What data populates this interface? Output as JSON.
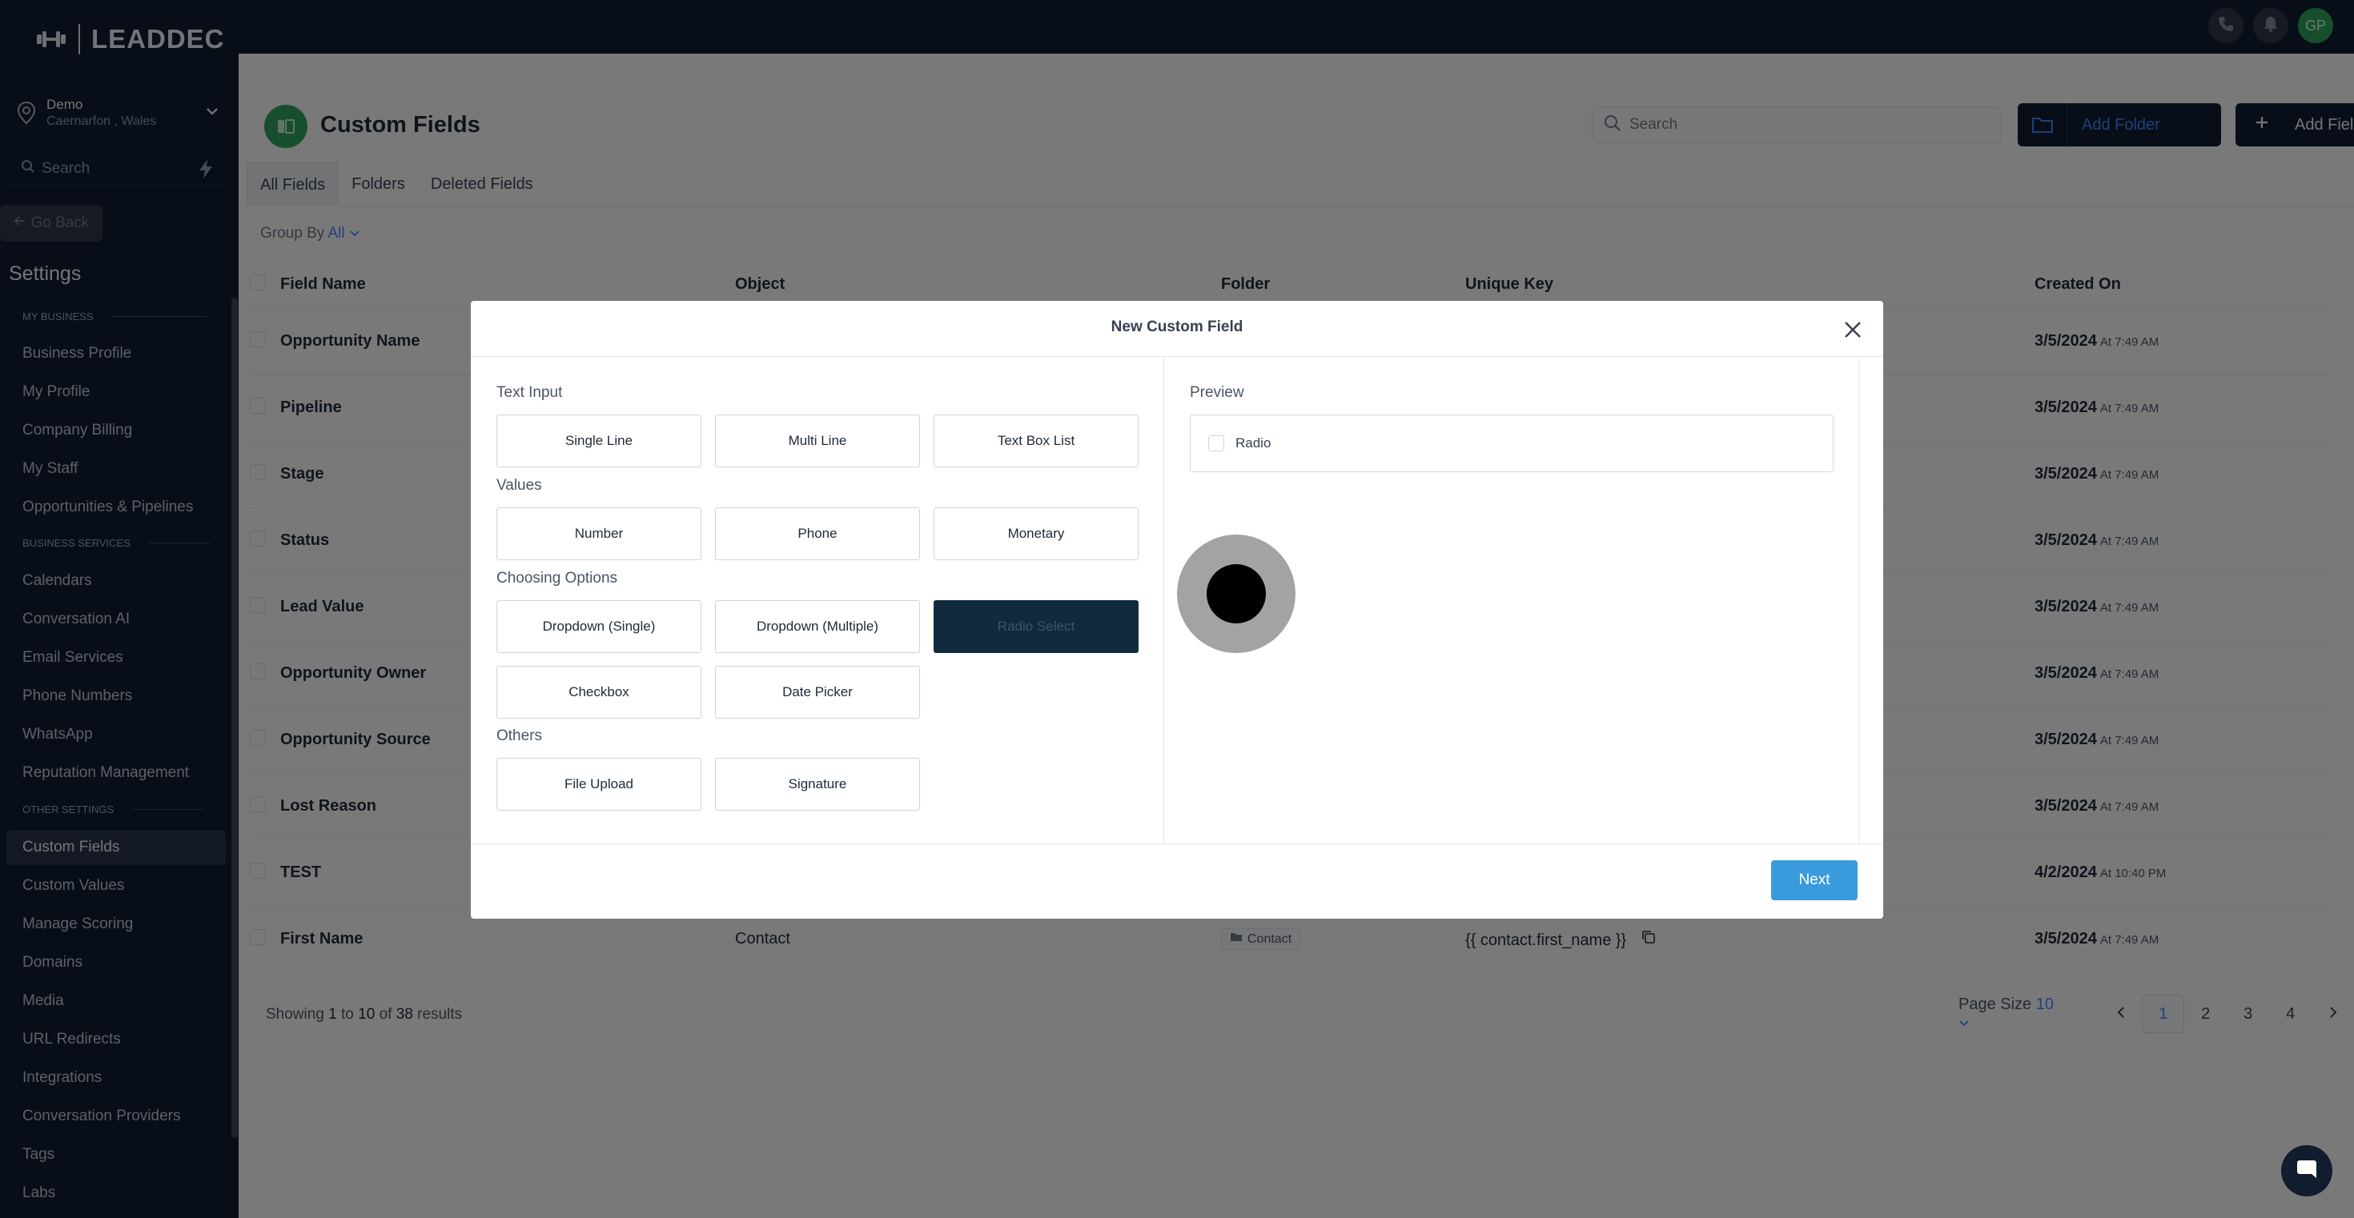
{
  "brand": {
    "name": "LEADDEC"
  },
  "location": {
    "name": "Demo",
    "sub": "Caernarfon , Wales"
  },
  "sidebar": {
    "search_placeholder": "Search",
    "go_back": "Go Back",
    "settings_title": "Settings",
    "sections": [
      {
        "label": "MY BUSINESS",
        "items": [
          "Business Profile",
          "My Profile",
          "Company Billing",
          "My Staff",
          "Opportunities & Pipelines"
        ]
      },
      {
        "label": "BUSINESS SERVICES",
        "items": [
          "Calendars",
          "Conversation AI",
          "Email Services",
          "Phone Numbers",
          "WhatsApp",
          "Reputation Management"
        ]
      },
      {
        "label": "OTHER SETTINGS",
        "items": [
          "Custom Fields",
          "Custom Values",
          "Manage Scoring",
          "Domains",
          "Media",
          "URL Redirects",
          "Integrations",
          "Conversation Providers",
          "Tags",
          "Labs"
        ]
      }
    ],
    "active_item": "Custom Fields"
  },
  "topbar": {
    "avatar_initials": "GP"
  },
  "page": {
    "title": "Custom Fields",
    "search_placeholder": "Search",
    "add_folder": "Add Folder",
    "add_field": "Add Field",
    "tabs": [
      "All Fields",
      "Folders",
      "Deleted Fields"
    ],
    "group_by_label": "Group By",
    "group_by_value": "All"
  },
  "table": {
    "columns": [
      "Field Name",
      "Object",
      "Folder",
      "Unique Key",
      "Created On"
    ],
    "rows": [
      {
        "name": "Opportunity Name",
        "object": "",
        "folder": "",
        "key": "",
        "date": "3/5/2024",
        "time": "At 7:49 AM"
      },
      {
        "name": "Pipeline",
        "object": "",
        "folder": "",
        "key": "",
        "date": "3/5/2024",
        "time": "At 7:49 AM"
      },
      {
        "name": "Stage",
        "object": "",
        "folder": "",
        "key": "",
        "date": "3/5/2024",
        "time": "At 7:49 AM"
      },
      {
        "name": "Status",
        "object": "",
        "folder": "",
        "key": "",
        "date": "3/5/2024",
        "time": "At 7:49 AM"
      },
      {
        "name": "Lead Value",
        "object": "",
        "folder": "",
        "key": "",
        "date": "3/5/2024",
        "time": "At 7:49 AM"
      },
      {
        "name": "Opportunity Owner",
        "object": "",
        "folder": "",
        "key": "",
        "date": "3/5/2024",
        "time": "At 7:49 AM"
      },
      {
        "name": "Opportunity Source",
        "object": "",
        "folder": "",
        "key": "",
        "date": "3/5/2024",
        "time": "At 7:49 AM"
      },
      {
        "name": "Lost Reason",
        "object": "",
        "folder": "",
        "key": "",
        "date": "3/5/2024",
        "time": "At 7:49 AM"
      },
      {
        "name": "TEST",
        "object": "",
        "folder": "",
        "key": "",
        "date": "4/2/2024",
        "time": "At 10:40 PM"
      },
      {
        "name": "First Name",
        "object": "Contact",
        "folder": "Contact",
        "key": "{{ contact.first_name }}",
        "date": "3/5/2024",
        "time": "At 7:49 AM"
      }
    ]
  },
  "footer": {
    "showing_prefix": "Showing",
    "from": "1",
    "to_word": "to",
    "to": "10",
    "of_word": "of",
    "total": "38",
    "results": "results",
    "page_size_label": "Page Size",
    "page_size": "10",
    "pages": [
      "1",
      "2",
      "3",
      "4"
    ]
  },
  "modal": {
    "title": "New Custom Field",
    "groups": [
      {
        "label": "Text Input",
        "options": [
          "Single Line",
          "Multi Line",
          "Text Box List"
        ]
      },
      {
        "label": "Values",
        "options": [
          "Number",
          "Phone",
          "Monetary"
        ]
      },
      {
        "label": "Choosing Options",
        "options": [
          "Dropdown (Single)",
          "Dropdown (Multiple)",
          "Radio Select",
          "Checkbox",
          "Date Picker"
        ]
      },
      {
        "label": "Others",
        "options": [
          "File Upload",
          "Signature"
        ]
      }
    ],
    "selected": "Radio Select",
    "preview_label": "Preview",
    "preview_option": "Radio",
    "next": "Next"
  },
  "colors": {
    "sidebar_bg": "#111c2e",
    "accent": "#3a9bdc",
    "selected_option": "#0f2b3d",
    "brand_green": "#2f9e5d"
  }
}
